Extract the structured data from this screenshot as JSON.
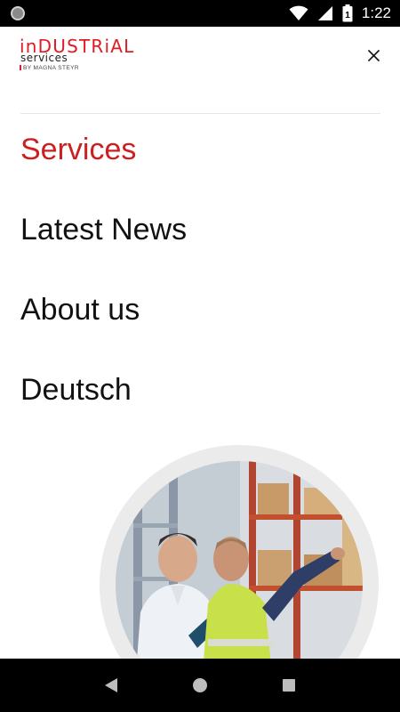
{
  "status_bar": {
    "time": "1:22",
    "battery_level": "1",
    "icons": [
      "notification-dot-icon",
      "wifi-icon",
      "cellular-signal-icon",
      "battery-charging-icon"
    ]
  },
  "header": {
    "logo": {
      "main_text": "inDUSTRiAL",
      "sub_text": "services",
      "by_text": "BY MAGNA STEYR"
    },
    "close_icon": "close-icon"
  },
  "menu": {
    "items": [
      {
        "label": "Services",
        "active": true
      },
      {
        "label": "Latest News",
        "active": false
      },
      {
        "label": "About us",
        "active": false
      },
      {
        "label": "Deutsch",
        "active": false
      }
    ]
  },
  "colors": {
    "brand_red": "#e01b22",
    "active_item": "#cc1f1f",
    "text": "#111111",
    "divider": "#e6e6e6",
    "image_ring": "#ebebeb"
  },
  "nav_bar": {
    "icons": [
      "back-icon",
      "home-icon",
      "recents-icon"
    ]
  }
}
